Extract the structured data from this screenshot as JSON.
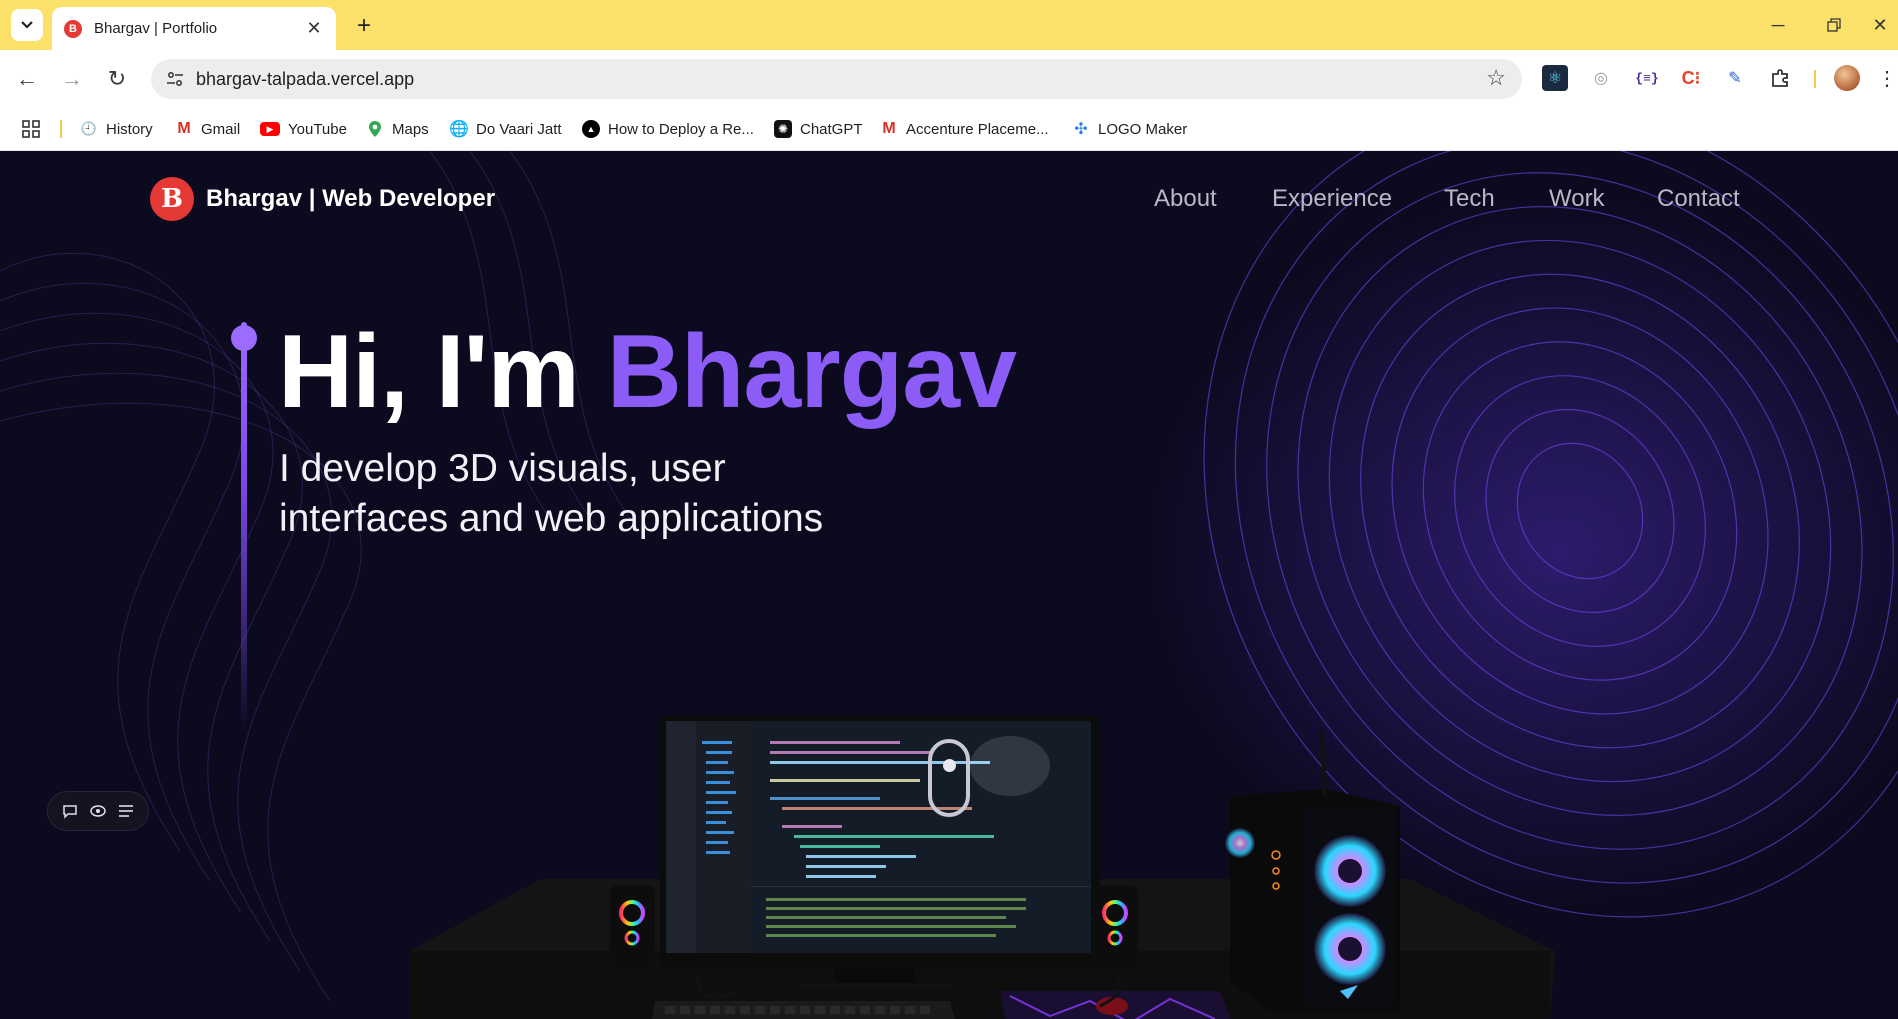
{
  "browser": {
    "tab": {
      "title": "Bhargav | Portfolio",
      "favicon": "B"
    },
    "address": {
      "url": "bhargav-talpada.vercel.app"
    },
    "bookmarks": [
      {
        "label": "History",
        "icon": "history-icon"
      },
      {
        "label": "Gmail",
        "icon": "gmail-icon"
      },
      {
        "label": "YouTube",
        "icon": "youtube-icon"
      },
      {
        "label": "Maps",
        "icon": "maps-icon"
      },
      {
        "label": "Do Vaari Jatt",
        "icon": "globe-icon"
      },
      {
        "label": "How to Deploy a Re...",
        "icon": "vercel-icon"
      },
      {
        "label": "ChatGPT",
        "icon": "chatgpt-icon"
      },
      {
        "label": "Accenture Placeme...",
        "icon": "gmail-icon"
      },
      {
        "label": "LOGO Maker",
        "icon": "logo-maker-icon"
      }
    ],
    "theme_color": "#fbe16a"
  },
  "site": {
    "brand": {
      "logo_letter": "B",
      "name": "Bhargav | Web Developer"
    },
    "nav": [
      "About",
      "Experience",
      "Tech",
      "Work",
      "Contact"
    ],
    "hero": {
      "greeting": "Hi, I'm ",
      "name": "Bhargav",
      "subtitle_line1": "I develop 3D visuals, user",
      "subtitle_line2": "interfaces and web applications"
    },
    "colors": {
      "background": "#0b0a1e",
      "accent": "#8b5cf6",
      "logo": "#e53935"
    }
  }
}
